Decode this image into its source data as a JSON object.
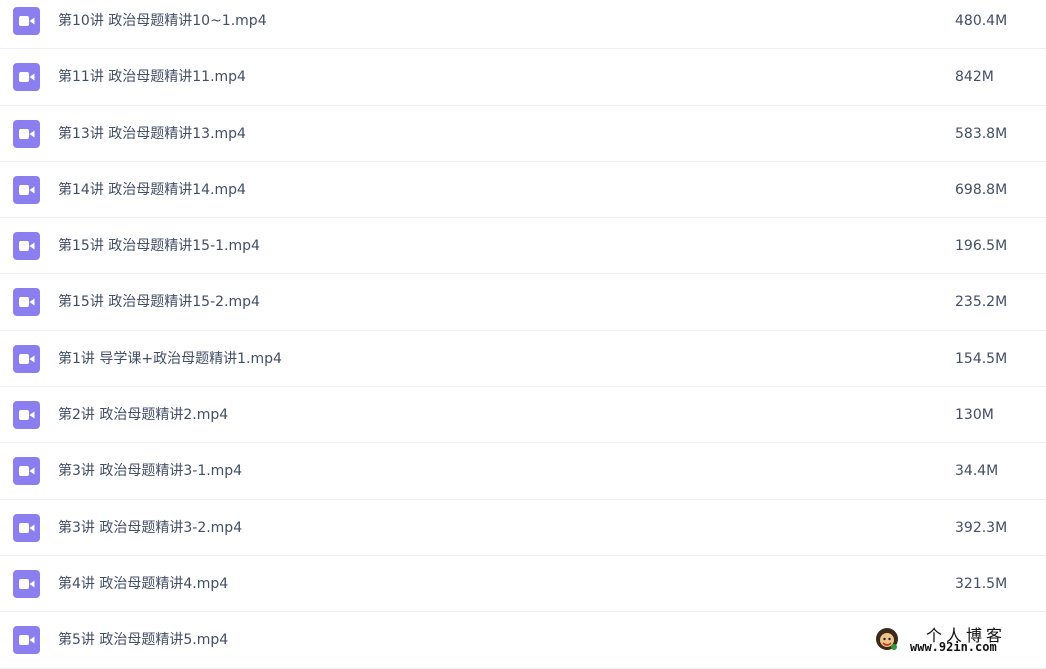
{
  "files": [
    {
      "name": "第10讲 政治母题精讲10~1.mp4",
      "size": "480.4M"
    },
    {
      "name": "第11讲 政治母题精讲11.mp4",
      "size": "842M"
    },
    {
      "name": "第13讲 政治母题精讲13.mp4",
      "size": "583.8M"
    },
    {
      "name": "第14讲 政治母题精讲14.mp4",
      "size": "698.8M"
    },
    {
      "name": "第15讲 政治母题精讲15-1.mp4",
      "size": "196.5M"
    },
    {
      "name": "第15讲 政治母题精讲15-2.mp4",
      "size": "235.2M"
    },
    {
      "name": "第1讲 导学课+政治母题精讲1.mp4",
      "size": "154.5M"
    },
    {
      "name": "第2讲 政治母题精讲2.mp4",
      "size": "130M"
    },
    {
      "name": "第3讲 政治母题精讲3-1.mp4",
      "size": "34.4M"
    },
    {
      "name": "第3讲 政治母题精讲3-2.mp4",
      "size": "392.3M"
    },
    {
      "name": "第4讲 政治母题精讲4.mp4",
      "size": "321.5M"
    },
    {
      "name": "第5讲 政治母题精讲5.mp4",
      "size": ""
    }
  ],
  "icon": {
    "name": "video-file-icon",
    "color": "#8b7ff0"
  },
  "watermark": {
    "title": "个人博客",
    "url": "www.92in.com"
  }
}
